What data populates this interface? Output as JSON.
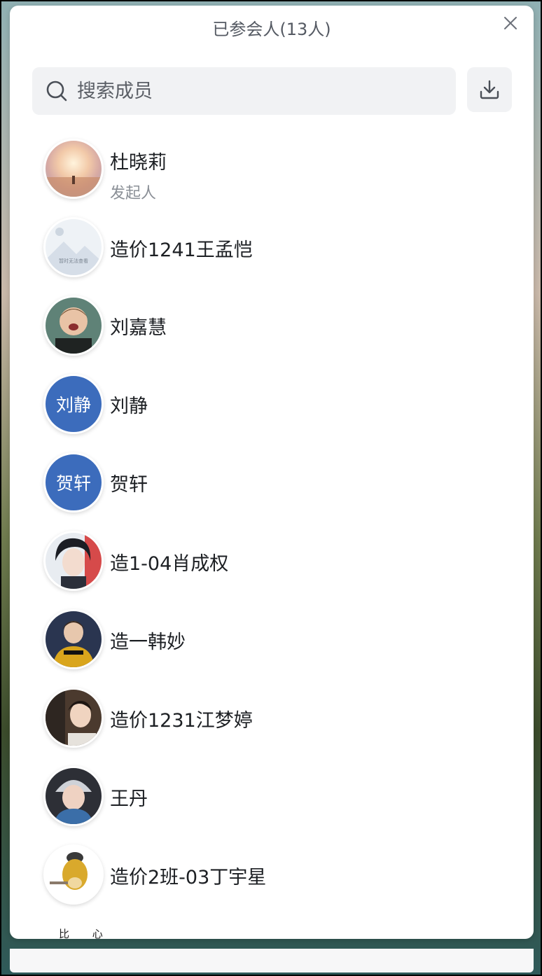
{
  "header": {
    "title": "已参会人(13人)"
  },
  "search": {
    "placeholder": "搜索成员"
  },
  "members": [
    {
      "name": "杜晓莉",
      "role": "发起人",
      "avatar": "photo"
    },
    {
      "name": "造价1241王孟恺",
      "avatar": "placeholder",
      "avatar_caption": "暂时无法查看"
    },
    {
      "name": "刘嘉慧",
      "avatar": "photo"
    },
    {
      "name": "刘静",
      "avatar": "text",
      "avatar_text": "刘静"
    },
    {
      "name": "贺轩",
      "avatar": "text",
      "avatar_text": "贺轩"
    },
    {
      "name": "造1-04肖成权",
      "avatar": "photo"
    },
    {
      "name": "造一韩妙",
      "avatar": "photo"
    },
    {
      "name": "造价1231江梦婷",
      "avatar": "photo"
    },
    {
      "name": "王丹",
      "avatar": "photo"
    },
    {
      "name": "造价2班-03丁宇星",
      "avatar": "photo"
    }
  ],
  "partial_row_text": "比 心",
  "colors": {
    "text_avatar_bg": "#3c6cbc",
    "search_bg": "#f1f2f4",
    "role_text": "#8a8f96"
  }
}
